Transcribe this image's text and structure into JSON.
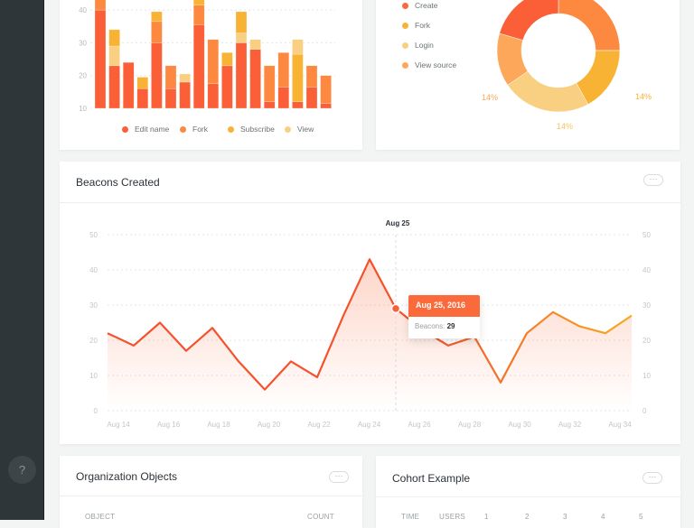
{
  "sidebar": {
    "help_label": "?"
  },
  "bar_card": {
    "chart_data": {
      "type": "bar",
      "stacked": true,
      "ylim": [
        10,
        43
      ],
      "yticks": [
        "10",
        "20",
        "30",
        "40"
      ],
      "grid": true,
      "legend": "bottom",
      "series": [
        {
          "name": "Edit name",
          "color": "#fb5f37"
        },
        {
          "name": "Fork",
          "color": "#fd8940"
        },
        {
          "name": "Subscribe",
          "color": "#f8b234"
        },
        {
          "name": "View",
          "color": "#f9d082"
        }
      ],
      "bars": [
        [
          [
            "Edit name",
            40
          ],
          [
            "Fork",
            5
          ]
        ],
        [
          [
            "Edit name",
            23
          ],
          [
            "View",
            6
          ],
          [
            "Subscribe",
            5
          ]
        ],
        [
          [
            "Edit name",
            24
          ]
        ],
        [
          [
            "Edit name",
            16
          ],
          [
            "Subscribe",
            3.5
          ]
        ],
        [
          [
            "Edit name",
            30
          ],
          [
            "Fork",
            6.5
          ],
          [
            "Subscribe",
            3
          ]
        ],
        [
          [
            "Edit name",
            16
          ],
          [
            "Fork",
            7
          ]
        ],
        [
          [
            "Edit name",
            18
          ],
          [
            "View",
            2.5
          ]
        ],
        [
          [
            "Edit name",
            35.5
          ],
          [
            "Fork",
            6
          ],
          [
            "Subscribe",
            2
          ]
        ],
        [
          [
            "Edit name",
            17.5
          ],
          [
            "Fork",
            13.5
          ]
        ],
        [
          [
            "Edit name",
            23
          ],
          [
            "Subscribe",
            4
          ]
        ],
        [
          [
            "Edit name",
            30
          ],
          [
            "View",
            3
          ],
          [
            "Subscribe",
            6.5
          ]
        ],
        [
          [
            "Edit name",
            28
          ],
          [
            "View",
            3
          ]
        ],
        [
          [
            "Edit name",
            12
          ],
          [
            "Fork",
            11
          ]
        ],
        [
          [
            "Edit name",
            16.5
          ],
          [
            "Fork",
            10.5
          ]
        ],
        [
          [
            "Edit name",
            12
          ],
          [
            "Subscribe",
            14.5
          ],
          [
            "View",
            4.5
          ]
        ],
        [
          [
            "Edit name",
            16.5
          ],
          [
            "Fork",
            6.5
          ]
        ],
        [
          [
            "Edit name",
            11.5
          ],
          [
            "Fork",
            8.5
          ]
        ]
      ]
    }
  },
  "pie_card": {
    "chart_data": {
      "type": "pie",
      "donut": true,
      "legend": "left",
      "slices": [
        {
          "name": "Create",
          "value": 25,
          "color": "#fd8940"
        },
        {
          "name": "Fork",
          "value": 17,
          "color": "#f8b234",
          "label": "14%"
        },
        {
          "name": "Login",
          "value": 23.5,
          "color": "#f9d082",
          "label": "14%"
        },
        {
          "name": "View source",
          "value": 14,
          "color": "#fda75a",
          "label": "14%"
        },
        {
          "name": "",
          "value": 20.5,
          "color": "#fb5f37"
        }
      ],
      "legend_items": [
        {
          "name": "Create",
          "color": "#fb6a3a"
        },
        {
          "name": "Fork",
          "color": "#f8b234"
        },
        {
          "name": "Login",
          "color": "#f9d082"
        },
        {
          "name": "View source",
          "color": "#fda75a"
        }
      ]
    }
  },
  "beacons_card": {
    "title": "Beacons Created",
    "more_label": "···",
    "chart_data": {
      "type": "area",
      "ylim": [
        0,
        50
      ],
      "yticks": [
        "0",
        "10",
        "20",
        "30",
        "40",
        "50"
      ],
      "xticks": [
        "Aug 14",
        "Aug 16",
        "Aug 18",
        "Aug 20",
        "Aug 22",
        "Aug 24",
        "Aug 26",
        "Aug 28",
        "Aug 30",
        "Aug 32",
        "Aug 34"
      ],
      "grid": true,
      "x": [
        "Aug 14",
        "Aug 15",
        "Aug 16",
        "Aug 17",
        "Aug 18",
        "Aug 19",
        "Aug 20",
        "Aug 21",
        "Aug 22",
        "Aug 23",
        "Aug 24",
        "Aug 25",
        "Aug 26",
        "Aug 27",
        "Aug 28",
        "Aug 29",
        "Aug 30",
        "Aug 31",
        "Aug 32",
        "Aug 33",
        "Aug 34"
      ],
      "values": [
        22,
        18.5,
        25,
        17,
        23.5,
        14,
        6,
        14,
        9.5,
        27,
        43,
        29,
        23,
        18.5,
        21,
        8,
        22,
        28,
        24,
        22,
        27
      ],
      "line_color_start": "#f4512c",
      "line_color_end": "#f7ab24",
      "hover": {
        "label": "Aug 25",
        "tooltip_title": "Aug 25, 2016",
        "tooltip_key": "Beacons:",
        "tooltip_value": "29"
      }
    }
  },
  "org_card": {
    "title": "Organization Objects",
    "more_label": "···",
    "columns": [
      "OBJECT",
      "COUNT"
    ]
  },
  "cohort_card": {
    "title": "Cohort Example",
    "more_label": "···",
    "columns": [
      "TIME",
      "USERS",
      "1",
      "2",
      "3",
      "4",
      "5"
    ]
  }
}
